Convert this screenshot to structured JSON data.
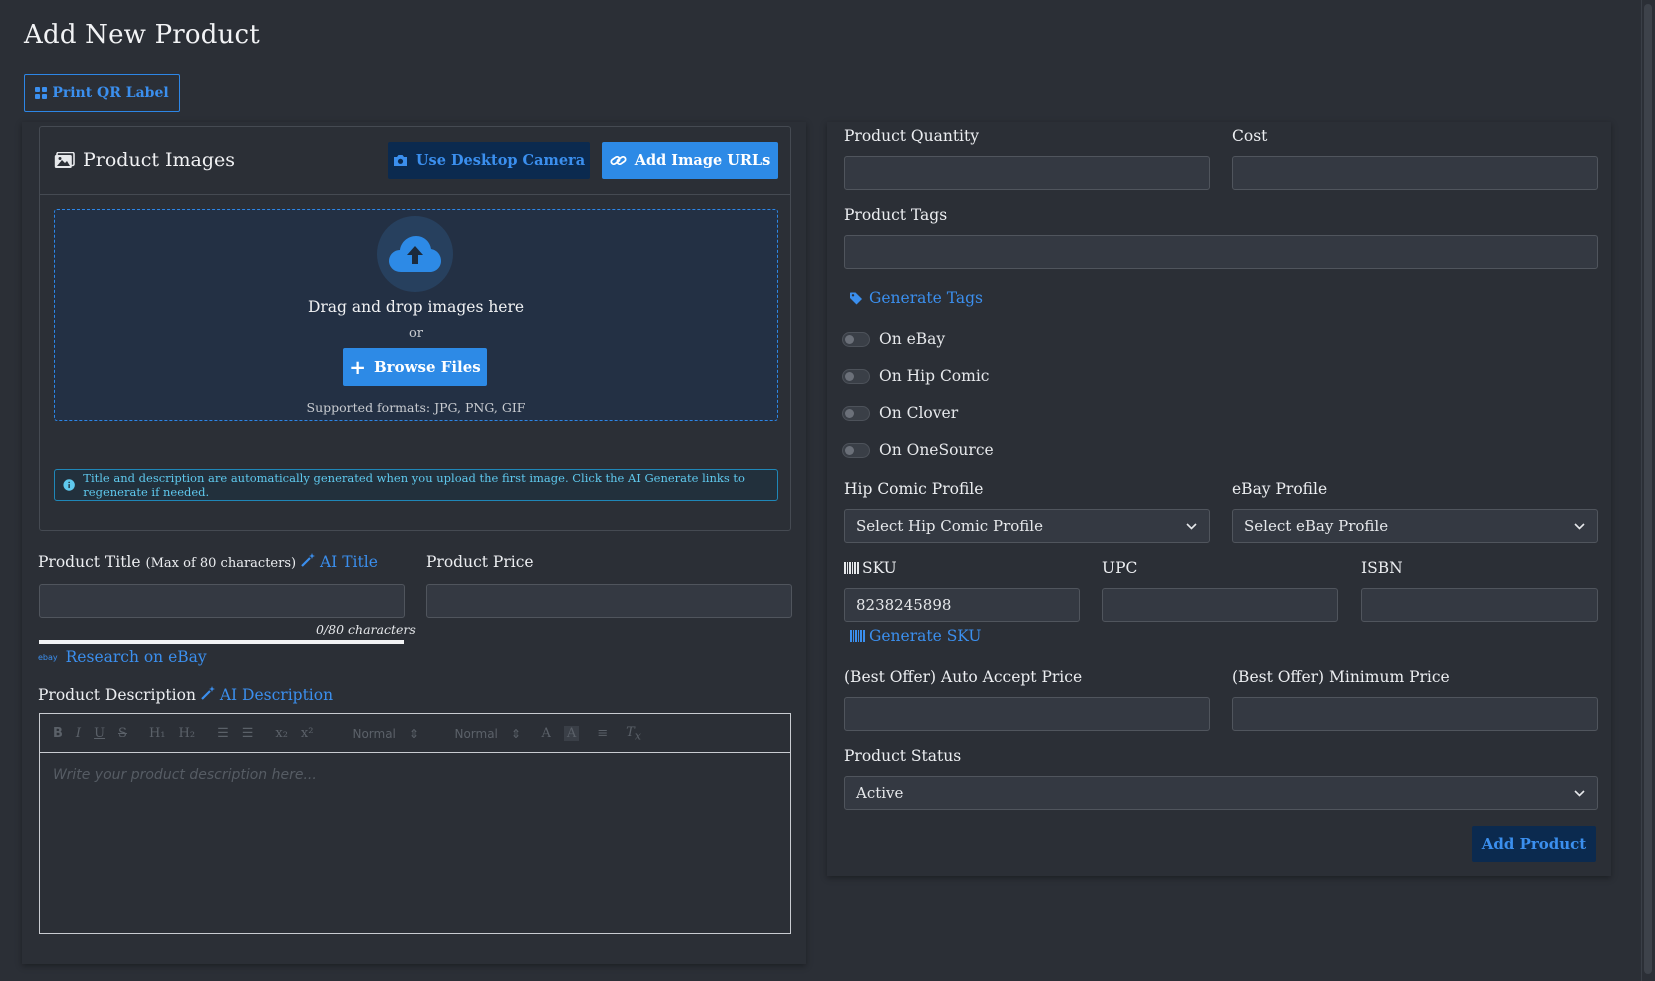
{
  "page": {
    "title": "Add New Product"
  },
  "toolbar": {
    "print_label": "Print QR Label"
  },
  "images": {
    "title": "Product Images",
    "camera_button": "Use Desktop Camera",
    "urls_button": "Add Image URLs",
    "drop_text": "Drag and drop images here",
    "or_text": "or",
    "browse_button": "Browse Files",
    "formats": "Supported formats: JPG, PNG, GIF",
    "info": "Title and description are automatically generated when you upload the first image. Click the AI Generate links to regenerate if needed."
  },
  "title_field": {
    "label": "Product Title",
    "hint": "(Max of 80 characters)",
    "ai_link": "AI Title",
    "value": "",
    "char_count": "0/80 characters",
    "research_logo": "ebay",
    "research_link": "Research on eBay"
  },
  "price_field": {
    "label": "Product Price",
    "value": ""
  },
  "description": {
    "label": "Product Description",
    "ai_link": "AI Description",
    "placeholder": "Write your product description here...",
    "toolbar": {
      "font_size": "Normal",
      "heading": "Normal"
    }
  },
  "quantity": {
    "label": "Product Quantity",
    "value": ""
  },
  "cost": {
    "label": "Cost",
    "value": ""
  },
  "tags": {
    "label": "Product Tags",
    "value": "",
    "generate_link": "Generate Tags"
  },
  "toggles": [
    {
      "label": "On eBay",
      "on": false
    },
    {
      "label": "On Hip Comic",
      "on": false
    },
    {
      "label": "On Clover",
      "on": false
    },
    {
      "label": "On OneSource",
      "on": false
    }
  ],
  "hip_profile": {
    "label": "Hip Comic Profile",
    "value": "Select Hip Comic Profile"
  },
  "ebay_profile": {
    "label": "eBay Profile",
    "value": "Select eBay Profile"
  },
  "sku": {
    "label": "SKU",
    "value": "8238245898",
    "generate_link": "Generate SKU"
  },
  "upc": {
    "label": "UPC",
    "value": ""
  },
  "isbn": {
    "label": "ISBN",
    "value": ""
  },
  "auto_accept": {
    "label": "(Best Offer) Auto Accept Price",
    "value": ""
  },
  "min_price": {
    "label": "(Best Offer) Minimum Price",
    "value": ""
  },
  "status": {
    "label": "Product Status",
    "value": "Active"
  },
  "submit": {
    "label": "Add Product"
  },
  "colors": {
    "accent": "#2d8ae6",
    "link": "#3b8fee",
    "background": "#2b2f36",
    "dark_button": "#0b2a4f"
  }
}
